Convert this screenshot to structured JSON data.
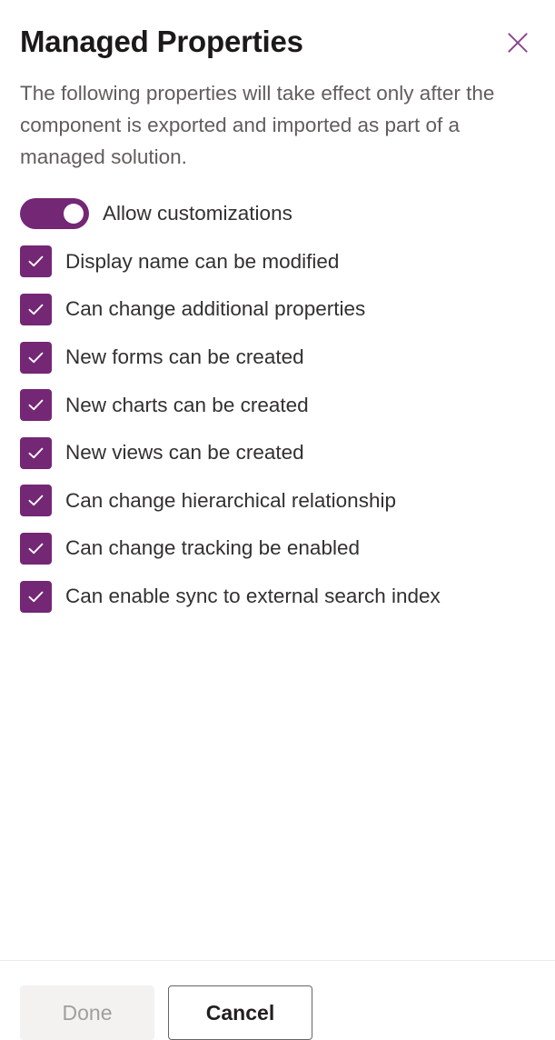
{
  "header": {
    "title": "Managed Properties",
    "close_icon": "close-icon",
    "description": "The following properties will take effect only after the component is exported and imported as part of a managed solution."
  },
  "options": [
    {
      "type": "toggle",
      "label": "Allow customizations",
      "checked": true,
      "name": "allow-customizations"
    },
    {
      "type": "checkbox",
      "label": "Display name can be modified",
      "checked": true,
      "name": "display-name-can-be-modified"
    },
    {
      "type": "checkbox",
      "label": "Can change additional properties",
      "checked": true,
      "name": "can-change-additional-properties"
    },
    {
      "type": "checkbox",
      "label": "New forms can be created",
      "checked": true,
      "name": "new-forms-can-be-created"
    },
    {
      "type": "checkbox",
      "label": "New charts can be created",
      "checked": true,
      "name": "new-charts-can-be-created"
    },
    {
      "type": "checkbox",
      "label": "New views can be created",
      "checked": true,
      "name": "new-views-can-be-created"
    },
    {
      "type": "checkbox",
      "label": "Can change hierarchical relationship",
      "checked": true,
      "name": "can-change-hierarchical-relationship"
    },
    {
      "type": "checkbox",
      "label": "Can change tracking be enabled",
      "checked": true,
      "name": "can-change-tracking-be-enabled"
    },
    {
      "type": "checkbox",
      "label": "Can enable sync to external search index",
      "checked": true,
      "name": "can-enable-sync-to-external-search-index"
    }
  ],
  "footer": {
    "done_label": "Done",
    "done_disabled": true,
    "cancel_label": "Cancel"
  },
  "colors": {
    "accent_purple": "#742774",
    "title_text": "#1b1a19",
    "body_text": "#323130",
    "muted_text": "#605e5c",
    "disabled_text": "#a19f9d",
    "disabled_bg": "#f3f2f1",
    "divider": "#edebe9",
    "cancel_border": "#656565"
  }
}
